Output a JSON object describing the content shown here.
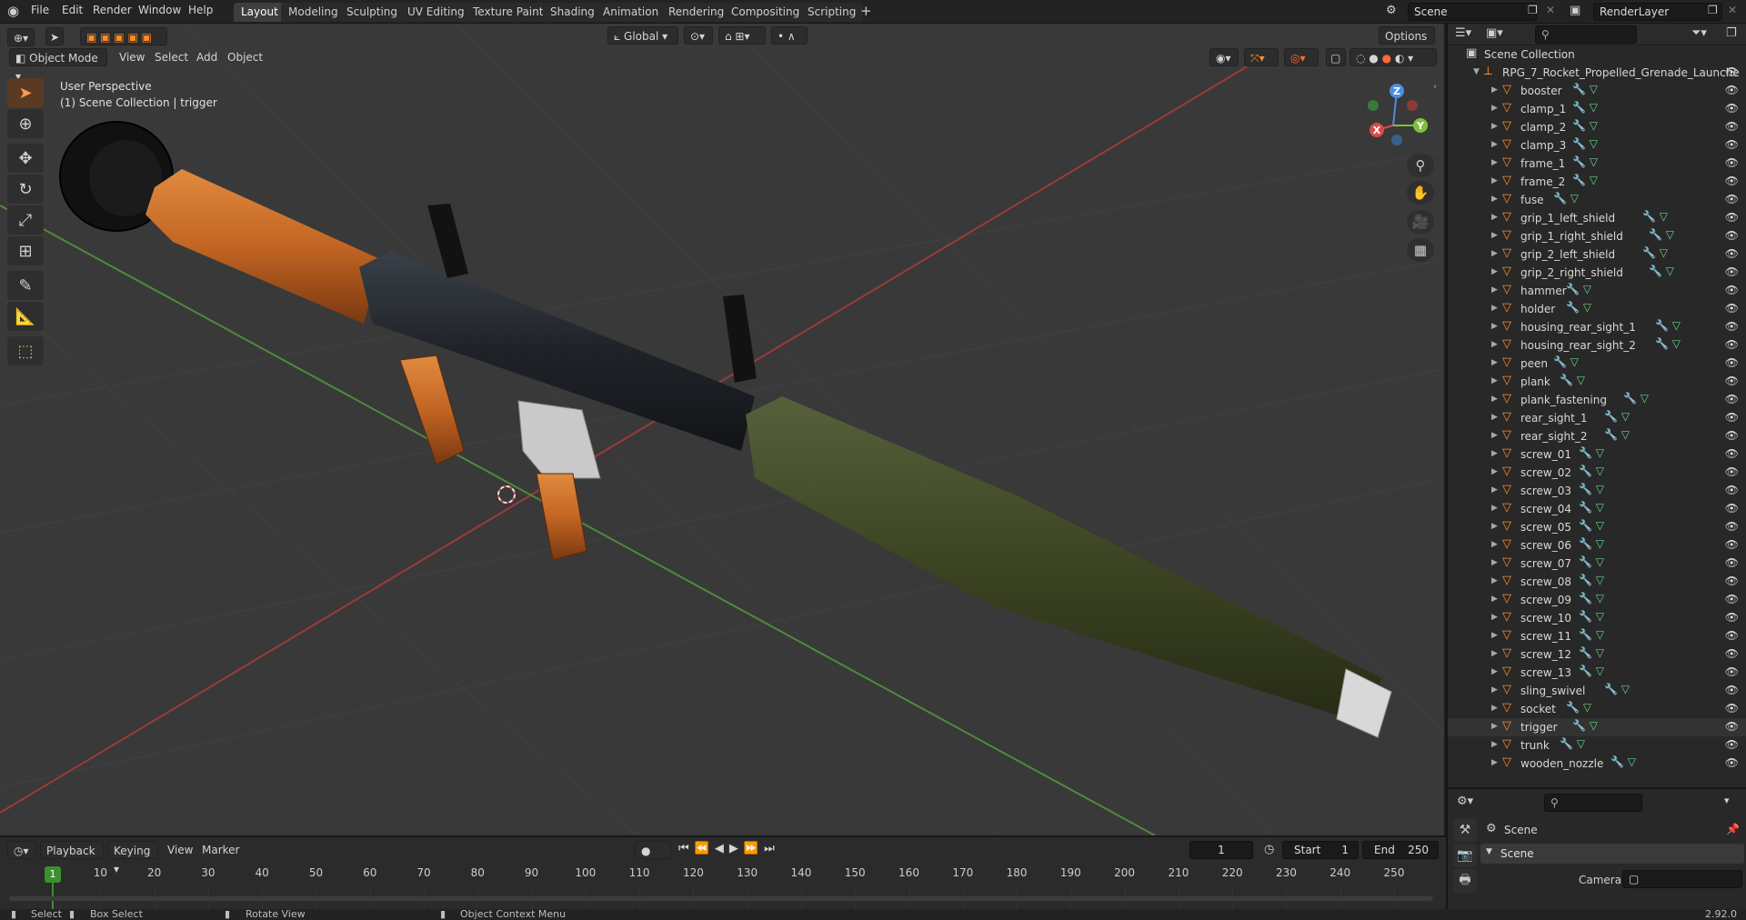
{
  "app": {
    "name": "Blender",
    "version": "2.92.0"
  },
  "top_menu": [
    "File",
    "Edit",
    "Render",
    "Window",
    "Help"
  ],
  "workspaces": [
    {
      "label": "Layout",
      "active": true
    },
    {
      "label": "Modeling",
      "active": false
    },
    {
      "label": "Sculpting",
      "active": false
    },
    {
      "label": "UV Editing",
      "active": false
    },
    {
      "label": "Texture Paint",
      "active": false
    },
    {
      "label": "Shading",
      "active": false
    },
    {
      "label": "Animation",
      "active": false
    },
    {
      "label": "Rendering",
      "active": false
    },
    {
      "label": "Compositing",
      "active": false
    },
    {
      "label": "Scripting",
      "active": false
    }
  ],
  "add_workspace_symbol": "+",
  "scene_field": "Scene",
  "renderlayer_field": "RenderLayer",
  "viewport": {
    "mode": "Object Mode",
    "menus": [
      "View",
      "Select",
      "Add",
      "Object"
    ],
    "transform_orientation": "Global",
    "options_label": "Options",
    "overlay_title": "User Perspective",
    "overlay_subtitle": "(1) Scene Collection | trigger",
    "gizmo_axes": {
      "x": "X",
      "y": "Y",
      "z": "Z"
    }
  },
  "toolbar_icons": [
    "select-box-icon",
    "cursor-icon",
    "move-icon",
    "rotate-icon",
    "scale-icon",
    "transform-icon",
    "annotate-icon",
    "measure-icon",
    "add-cube-icon"
  ],
  "outliner": {
    "root": "Scene Collection",
    "collection": "RPG_7_Rocket_Propelled_Grenade_Launche",
    "objects": [
      "booster",
      "clamp_1",
      "clamp_2",
      "clamp_3",
      "frame_1",
      "frame_2",
      "fuse",
      "grip_1_left_shield",
      "grip_1_right_shield",
      "grip_2_left_shield",
      "grip_2_right_shield",
      "hammer",
      "holder",
      "housing_rear_sight_1",
      "housing_rear_sight_2",
      "peen",
      "plank",
      "plank_fastening",
      "rear_sight_1",
      "rear_sight_2",
      "screw_01",
      "screw_02",
      "screw_03",
      "screw_04",
      "screw_05",
      "screw_06",
      "screw_07",
      "screw_08",
      "screw_09",
      "screw_10",
      "screw_11",
      "screw_12",
      "screw_13",
      "sling_swivel",
      "socket",
      "trigger",
      "trunk",
      "wooden_nozzle"
    ],
    "selected": "trigger"
  },
  "properties": {
    "context_label": "Scene",
    "panel_title": "Scene",
    "camera_label": "Camera"
  },
  "timeline": {
    "menus": [
      "Playback",
      "Keying",
      "View",
      "Marker"
    ],
    "current_frame": "1",
    "start_label": "Start",
    "start_value": "1",
    "end_label": "End",
    "end_value": "250",
    "ticks": [
      "1",
      "10",
      "20",
      "30",
      "40",
      "50",
      "60",
      "70",
      "80",
      "90",
      "100",
      "110",
      "120",
      "130",
      "140",
      "150",
      "160",
      "170",
      "180",
      "190",
      "200",
      "210",
      "220",
      "230",
      "240",
      "250"
    ]
  },
  "statusbar": {
    "select": "Select",
    "box_select": "Box Select",
    "rotate_view": "Rotate View",
    "context_menu": "Object Context Menu",
    "version": "2.92.0"
  },
  "colors": {
    "accent": "#ff8c2a",
    "selected_tool": "#5a3a22",
    "axis_x": "#d94b4b",
    "axis_y": "#7fc23a",
    "axis_z": "#4a8fe0",
    "playhead": "#3c8f2e",
    "wood": "#c86a2a",
    "warhead": "#3b4220"
  }
}
